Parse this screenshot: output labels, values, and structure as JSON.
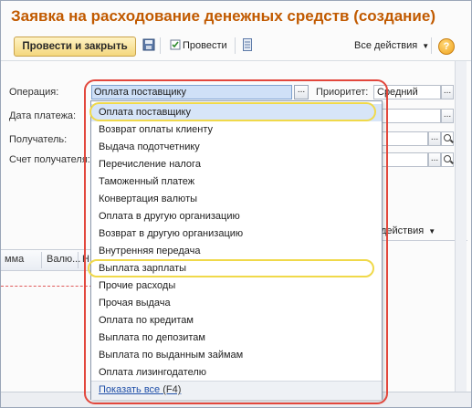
{
  "window": {
    "title": "Заявка на расходование денежных средств (создание)"
  },
  "toolbar": {
    "post_and_close": "Провести и закрыть",
    "post": "Провести",
    "all_actions": "Все действия",
    "help": "?"
  },
  "form": {
    "operation_label": "Операция:",
    "operation_value": "Оплата поставщику",
    "priority_label": "Приоритет:",
    "priority_value": "Средний",
    "payment_date_label": "Дата платежа:",
    "recipient_label": "Получатель:",
    "recipient_account_label": "Счет получателя:"
  },
  "table": {
    "col1": "мма",
    "col2": "Валю...",
    "col3": "Н",
    "actions": "действия"
  },
  "dropdown": {
    "items": [
      "Оплата поставщику",
      "Возврат оплаты клиенту",
      "Выдача подотчетнику",
      "Перечисление налога",
      "Таможенный платеж",
      "Конвертация валюты",
      "Оплата в другую организацию",
      "Возврат в другую организацию",
      "Внутренняя передача",
      "Выплата зарплаты",
      "Прочие расходы",
      "Прочая выдача",
      "Оплата по кредитам",
      "Выплата по депозитам",
      "Выплата по выданным займам",
      "Оплата лизингодателю"
    ],
    "show_all": "Показать все",
    "show_all_hotkey": "(F4)"
  },
  "colors": {
    "title": "#c15a00",
    "highlight_outline": "#e2473c",
    "oval": "#f0d94a",
    "selection": "#d7e5f8"
  }
}
